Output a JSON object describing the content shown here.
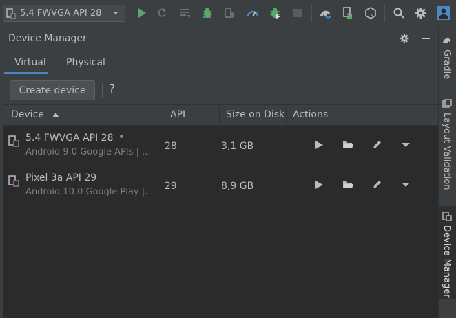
{
  "toolbar": {
    "device_selector": "5.4  FWVGA API 28",
    "icons": [
      "device-icon",
      "run-icon",
      "apply-changes-icon",
      "apply-code-changes-icon",
      "debug-icon",
      "attach-debugger-icon",
      "profile-icon",
      "run-with-coverage-icon",
      "stop-icon",
      "gradle-sync-icon",
      "device-manager-icon",
      "sdk-manager-icon",
      "search-icon",
      "settings-icon",
      "account-icon"
    ]
  },
  "panel": {
    "title": "Device Manager"
  },
  "tabs": [
    {
      "label": "Virtual",
      "selected": true
    },
    {
      "label": "Physical",
      "selected": false
    }
  ],
  "actions": {
    "create_device": "Create device",
    "help": "?"
  },
  "table": {
    "columns": {
      "device": "Device",
      "api": "API",
      "size": "Size on Disk",
      "actions": "Actions"
    },
    "rows": [
      {
        "name": "5.4  FWVGA API 28",
        "subtitle": "Android 9.0 Google APIs | ...",
        "api": "28",
        "size": "3,1 GB",
        "online": true
      },
      {
        "name": "Pixel 3a API 29",
        "subtitle": "Android 10.0 Google Play |...",
        "api": "29",
        "size": "8,9 GB",
        "online": false
      }
    ]
  },
  "right_sidebar": [
    {
      "label": "Gradle",
      "active": false
    },
    {
      "label": "Layout Validation",
      "active": false
    },
    {
      "label": "Device Manager",
      "active": true
    }
  ],
  "colors": {
    "background": "#3c3f41",
    "table_bg": "#2b2b2b",
    "accent": "#4a88c7",
    "run_green": "#59a869",
    "text": "#bbbbbb"
  }
}
